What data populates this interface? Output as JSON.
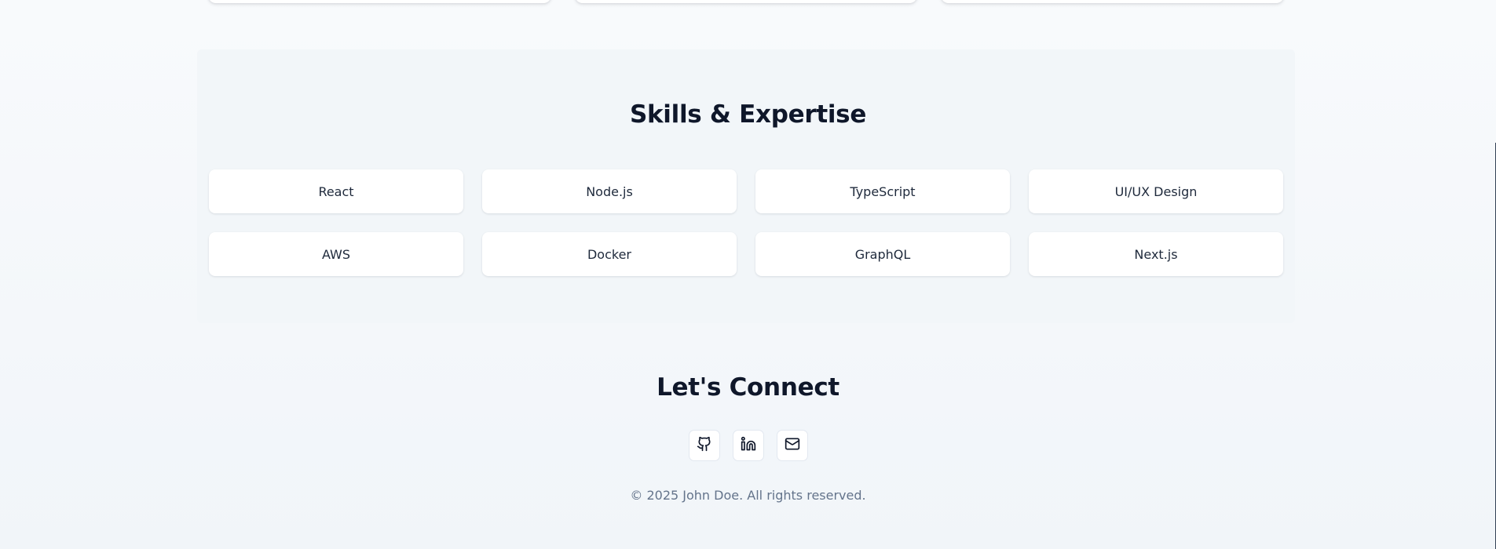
{
  "skills": {
    "title": "Skills & Expertise",
    "items": [
      {
        "label": "React"
      },
      {
        "label": "Node.js"
      },
      {
        "label": "TypeScript"
      },
      {
        "label": "UI/UX Design"
      },
      {
        "label": "AWS"
      },
      {
        "label": "Docker"
      },
      {
        "label": "GraphQL"
      },
      {
        "label": "Next.js"
      }
    ]
  },
  "connect": {
    "title": "Let's Connect",
    "links": [
      {
        "icon": "github-icon"
      },
      {
        "icon": "linkedin-icon"
      },
      {
        "icon": "mail-icon"
      }
    ],
    "copyright": "© 2025 John Doe. All rights reserved."
  }
}
